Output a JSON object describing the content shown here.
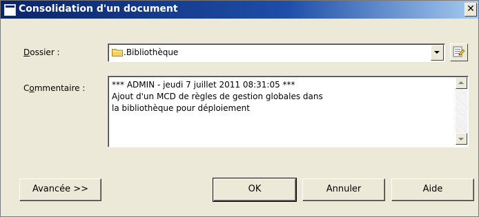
{
  "window": {
    "title": "Consolidation d'un document",
    "close_glyph": "✕"
  },
  "form": {
    "folder": {
      "label_mnemonic": "D",
      "label_rest": "ossier :",
      "value": ".Bibliothèque",
      "icon": "folder-icon"
    },
    "comment": {
      "label_prefix": "C",
      "label_mnemonic": "o",
      "label_rest": "mmentaire :",
      "lines": [
        "*** ADMIN - jeudi 7 juillet 2011 08:31:05 ***",
        "Ajout d'un MCD de règles de gestion globales dans",
        "la bibliothèque pour déploiement"
      ]
    }
  },
  "buttons": {
    "advanced": "Avancée >>",
    "ok": "OK",
    "cancel": "Annuler",
    "help": "Aide"
  },
  "colors": {
    "titlebar": "#0a246a",
    "dialog_bg": "#ece9d8"
  }
}
